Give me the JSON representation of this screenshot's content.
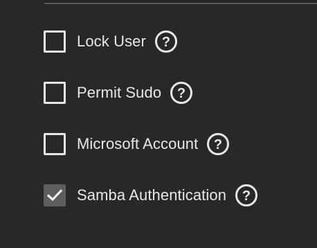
{
  "options": [
    {
      "label": "Lock User",
      "checked": false,
      "help_icon": "help-circle-icon"
    },
    {
      "label": "Permit Sudo",
      "checked": false,
      "help_icon": "help-circle-icon"
    },
    {
      "label": "Microsoft Account",
      "checked": false,
      "help_icon": "help-circle-icon"
    },
    {
      "label": "Samba Authentication",
      "checked": true,
      "help_icon": "help-circle-icon"
    }
  ],
  "colors": {
    "background": "#282828",
    "text": "#e8e8e8",
    "checkbox_border": "#e6e6e6",
    "checkbox_checked_fill": "#5e5e5e",
    "divider": "#5a5a5a"
  }
}
